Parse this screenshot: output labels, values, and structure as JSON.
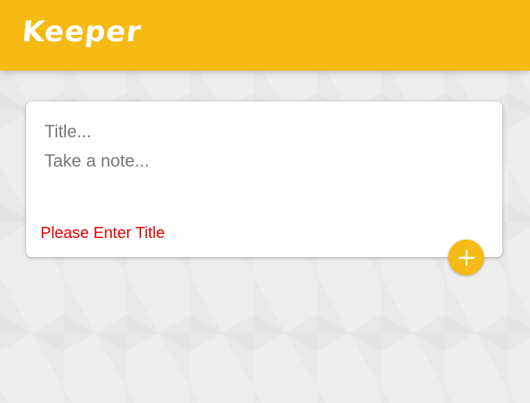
{
  "header": {
    "title": "Keeper"
  },
  "note_form": {
    "title_placeholder": "Title...",
    "content_placeholder": "Take a note...",
    "error_message": "Please Enter Title",
    "add_button_icon": "plus-icon"
  },
  "colors": {
    "accent": "#f5ba13",
    "error": "#e60000",
    "background": "#eeeeee"
  }
}
